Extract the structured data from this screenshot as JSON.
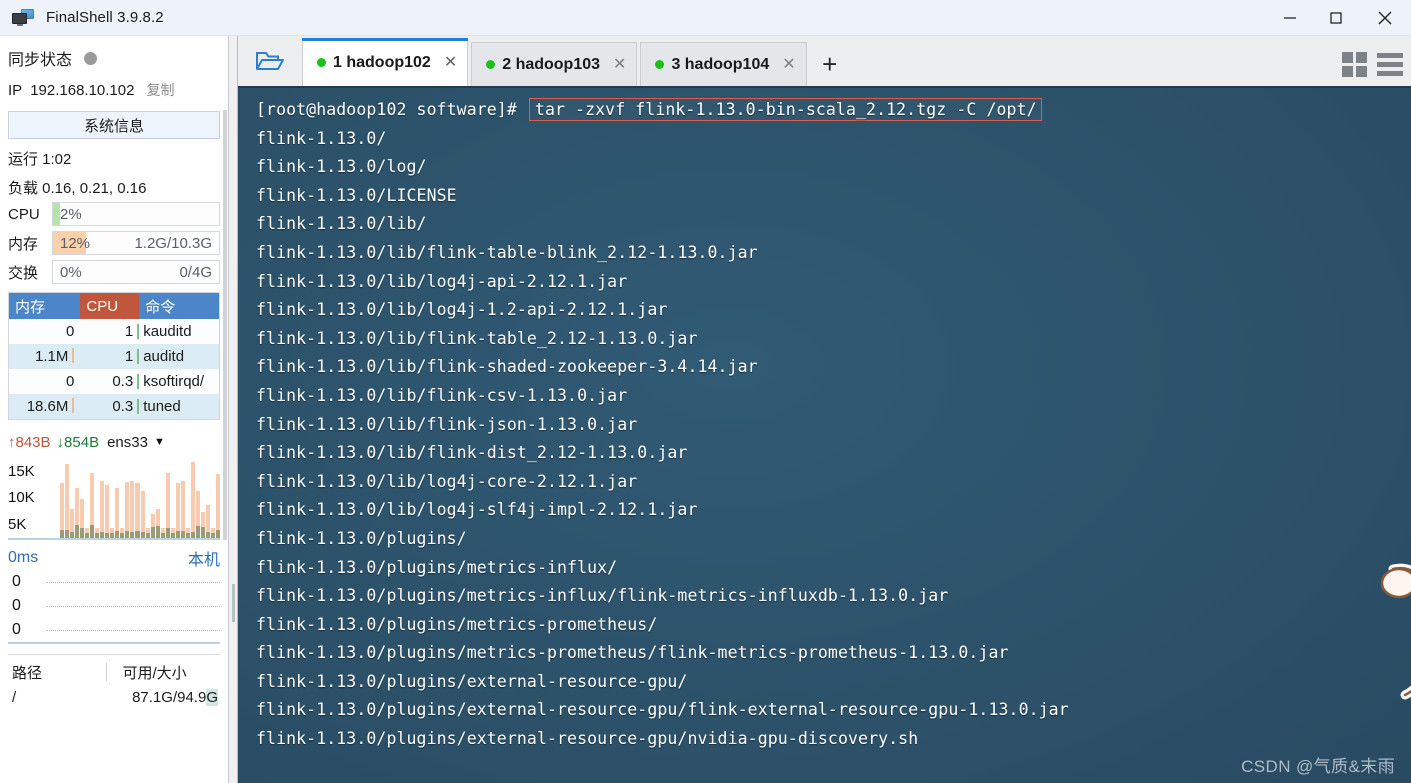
{
  "window": {
    "title": "FinalShell 3.9.8.2",
    "app_icon": "monitor-icon",
    "minimize": "–",
    "maximize": "□",
    "close": "✕"
  },
  "sidebar": {
    "sync_label": "同步状态",
    "sync_status_color": "#9b9b9b",
    "ip_label": "IP",
    "ip_value": "192.168.10.102",
    "copy_label": "复制",
    "sysinfo_button": "系统信息",
    "uptime": "运行 1:02",
    "load": "负载 0.16, 0.21, 0.16",
    "meters": [
      {
        "label": "CPU",
        "percent": "2%",
        "amount": "",
        "fill_width": "4%",
        "fill_color": "#b6e3a8"
      },
      {
        "label": "内存",
        "percent": "12%",
        "amount": "1.2G/10.3G",
        "fill_width": "20%",
        "fill_color": "#fbd0ab"
      },
      {
        "label": "交换",
        "percent": "0%",
        "amount": "0/4G",
        "fill_width": "0%",
        "fill_color": "#fbd0ab"
      }
    ],
    "process_table": {
      "headers": [
        "内存",
        "CPU",
        "命令"
      ],
      "header_colors": {
        "mem": "#4a86c8",
        "cpu": "#c0563c",
        "cmd": "#4a86c8"
      },
      "rows": [
        {
          "mem": "0",
          "cpu": "1",
          "cmd": "kauditd"
        },
        {
          "mem": "1.1M",
          "cpu": "1",
          "cmd": "auditd"
        },
        {
          "mem": "0",
          "cpu": "0.3",
          "cmd": "ksoftirqd/"
        },
        {
          "mem": "18.6M",
          "cpu": "0.3",
          "cmd": "tuned"
        }
      ]
    },
    "network": {
      "upload": "843B",
      "download": "854B",
      "upload_arrow": "↑",
      "download_arrow": "↓",
      "interface": "ens33",
      "caret": "▼",
      "y_labels": [
        "15K",
        "10K",
        "5K"
      ],
      "bars_upload": [
        11.5,
        15.4,
        6.0,
        10.3,
        8.1,
        2.0,
        13.5,
        2.0,
        11.8,
        11.0,
        2.0,
        10.4,
        2.0,
        11.6,
        11.8,
        11.5,
        9.8,
        2.0,
        5.0,
        6.1,
        2.0,
        13.5,
        2.0,
        11.5,
        11.8,
        2.0,
        15.7,
        9.8,
        5.4,
        6.8,
        2.0,
        13.2
      ],
      "bars_download": [
        1.6,
        1.7,
        1.2,
        2.6,
        2.0,
        1.0,
        2.6,
        1.1,
        1.3,
        1.1,
        1.1,
        1.5,
        1.0,
        1.4,
        1.3,
        1.5,
        1.2,
        1.0,
        2.2,
        2.4,
        1.1,
        2.0,
        1.0,
        1.4,
        1.5,
        1.1,
        1.3,
        2.4,
        2.2,
        1.3,
        1.0,
        1.6
      ]
    },
    "ping": {
      "latency": "0ms",
      "host": "本机",
      "rows": [
        "0",
        "0",
        "0"
      ]
    },
    "disk": {
      "headers": [
        "路径",
        "可用/大小"
      ],
      "rows": [
        {
          "path": "/",
          "size_avail": "87.1G/94.9",
          "size_unit": "G"
        }
      ]
    }
  },
  "tabbar": {
    "folder_icon": "open-folder-icon",
    "tabs": [
      {
        "label": "1 hadoop102",
        "status_color": "#19c119",
        "close": "✕",
        "active": true
      },
      {
        "label": "2 hadoop103",
        "status_color": "#19c119",
        "close": "✕",
        "active": false
      },
      {
        "label": "3 hadoop104",
        "status_color": "#19c119",
        "close": "✕",
        "active": false
      }
    ],
    "add_tab": "+",
    "grid_view_icon": "grid-view-icon",
    "list_view_icon": "list-view-icon"
  },
  "terminal": {
    "prompt": "[root@hadoop102 software]#",
    "command": "tar -zxvf flink-1.13.0-bin-scala_2.12.tgz -C /opt/",
    "command_highlight_color": "#e05a4e",
    "background_color": "#2c5169",
    "text_color": "#ffffff",
    "output_lines": [
      "flink-1.13.0/",
      "flink-1.13.0/log/",
      "flink-1.13.0/LICENSE",
      "flink-1.13.0/lib/",
      "flink-1.13.0/lib/flink-table-blink_2.12-1.13.0.jar",
      "flink-1.13.0/lib/log4j-api-2.12.1.jar",
      "flink-1.13.0/lib/log4j-1.2-api-2.12.1.jar",
      "flink-1.13.0/lib/flink-table_2.12-1.13.0.jar",
      "flink-1.13.0/lib/flink-shaded-zookeeper-3.4.14.jar",
      "flink-1.13.0/lib/flink-csv-1.13.0.jar",
      "flink-1.13.0/lib/flink-json-1.13.0.jar",
      "flink-1.13.0/lib/flink-dist_2.12-1.13.0.jar",
      "flink-1.13.0/lib/log4j-core-2.12.1.jar",
      "flink-1.13.0/lib/log4j-slf4j-impl-2.12.1.jar",
      "flink-1.13.0/plugins/",
      "flink-1.13.0/plugins/metrics-influx/",
      "flink-1.13.0/plugins/metrics-influx/flink-metrics-influxdb-1.13.0.jar",
      "flink-1.13.0/plugins/metrics-prometheus/",
      "flink-1.13.0/plugins/metrics-prometheus/flink-metrics-prometheus-1.13.0.jar",
      "flink-1.13.0/plugins/external-resource-gpu/",
      "flink-1.13.0/plugins/external-resource-gpu/flink-external-resource-gpu-1.13.0.jar",
      "flink-1.13.0/plugins/external-resource-gpu/nvidia-gpu-discovery.sh"
    ],
    "watermark": "CSDN @气质&末雨"
  }
}
